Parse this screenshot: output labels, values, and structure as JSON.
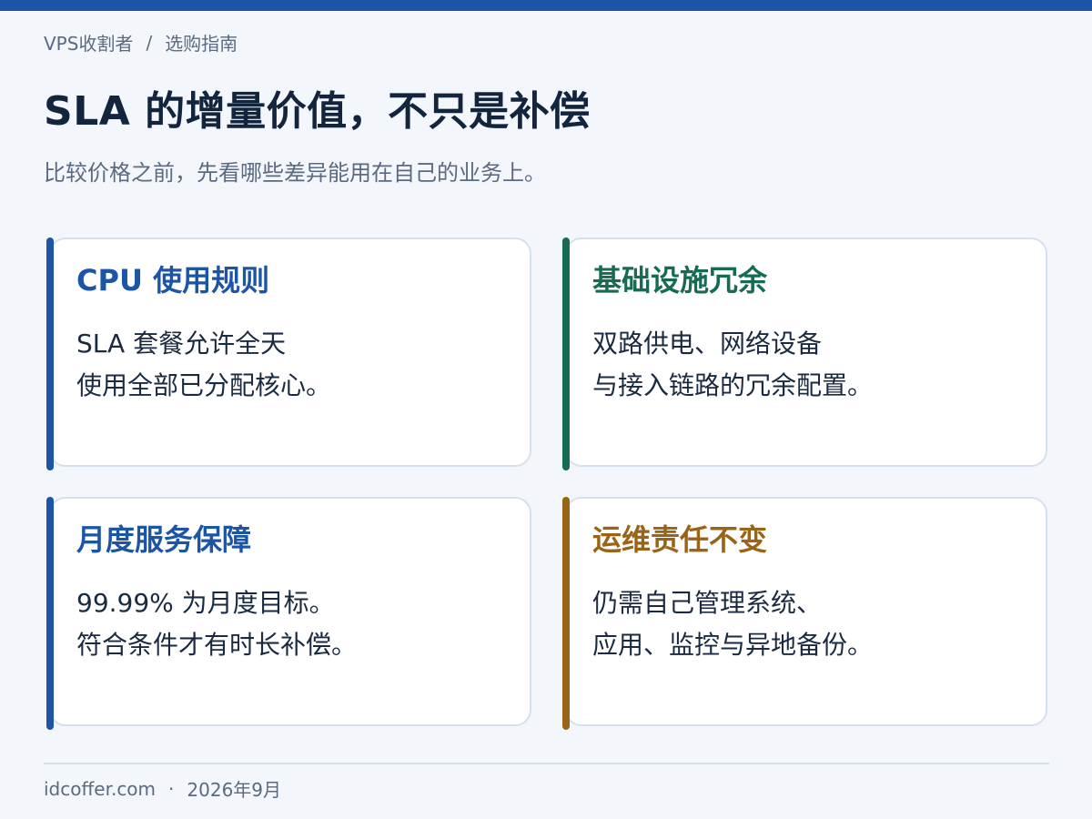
{
  "breadcrumb": {
    "site": "VPS收割者",
    "separator": "/",
    "section": "选购指南"
  },
  "title": "SLA 的增量价值，不只是补偿",
  "subtitle": "比较价格之前，先看哪些差异能用在自己的业务上。",
  "cards": [
    {
      "title": "CPU 使用规则",
      "lines": [
        "SLA 套餐允许全天",
        "使用全部已分配核心。"
      ],
      "accent_color": "#1c55a5"
    },
    {
      "title": "基础设施冗余",
      "lines": [
        "双路供电、网络设备",
        "与接入链路的冗余配置。"
      ],
      "accent_color": "#176b55"
    },
    {
      "title": "月度服务保障",
      "lines": [
        "99.99% 为月度目标。",
        "符合条件才有时长补偿。"
      ],
      "accent_color": "#1c55a5"
    },
    {
      "title": "运维责任不变",
      "lines": [
        "仍需自己管理系统、",
        "应用、监控与异地备份。"
      ],
      "accent_color": "#9a6315"
    }
  ],
  "footer": {
    "domain": "idcoffer.com",
    "separator": "·",
    "date": "2026年9月"
  },
  "colors": {
    "top_bar": "#1c55a5",
    "background": "#f3f6fb",
    "title": "#13243d",
    "muted_text": "#5a6a80"
  }
}
